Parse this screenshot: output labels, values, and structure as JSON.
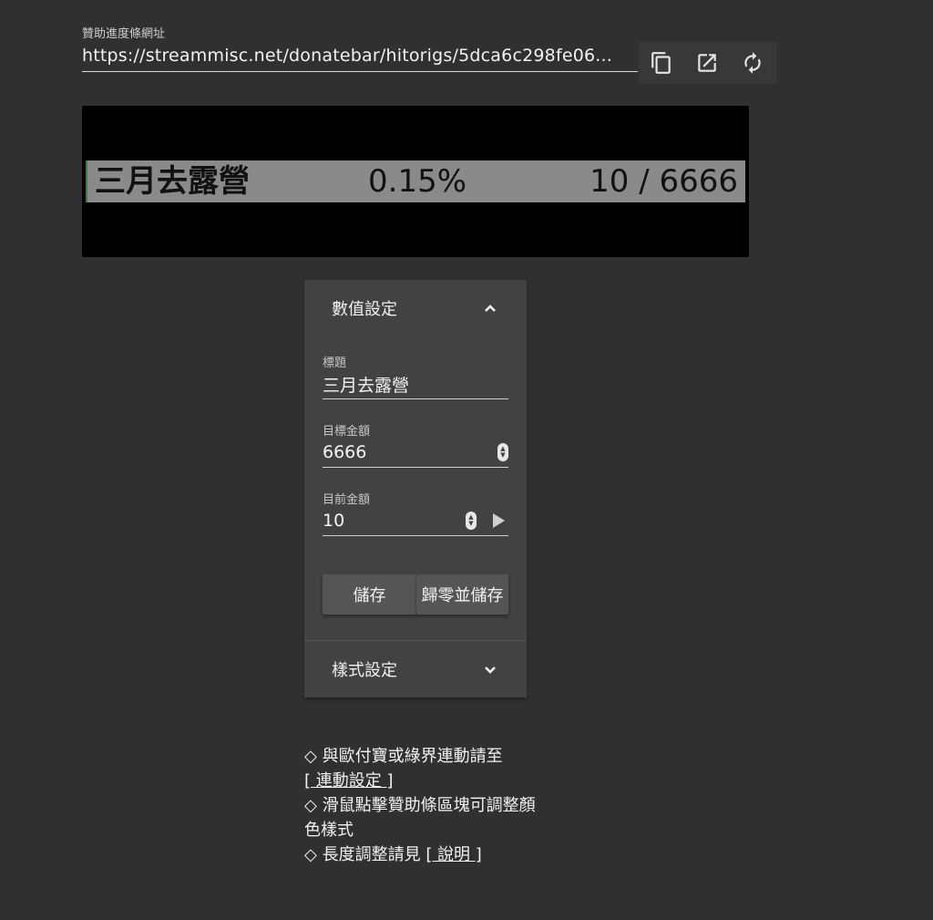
{
  "url_section": {
    "label": "贊助進度條網址",
    "value": "https://streammisc.net/donatebar/hitorigs/5dca6c298fe06..."
  },
  "url_actions": [
    "copy-icon",
    "open-external-icon",
    "refresh-icon"
  ],
  "preview": {
    "title": "三月去露營",
    "percent": "0.15%",
    "amount": "10 / 6666",
    "progress_fraction": 0.0015
  },
  "value_panel": {
    "header": "數值設定",
    "fields": {
      "title_label": "標題",
      "title_value": "三月去露營",
      "target_label": "目標金額",
      "target_value": "6666",
      "current_label": "目前金額",
      "current_value": "10"
    },
    "save_label": "儲存",
    "reset_label": "歸零並儲存"
  },
  "style_panel": {
    "header": "樣式設定"
  },
  "notes": {
    "line1": "◇ 與歐付寶或綠界連動請至",
    "link1": "[ 連動設定 ]",
    "line2": "◇ 滑鼠點擊贊助條區塊可調整顏色樣式",
    "line3": "◇ 長度調整請見",
    "link3": "[ 說明 ]"
  },
  "colors": {
    "background": "#303030",
    "panel": "#424242",
    "bar": "#8a8a8a",
    "preview_bg": "#000000"
  }
}
